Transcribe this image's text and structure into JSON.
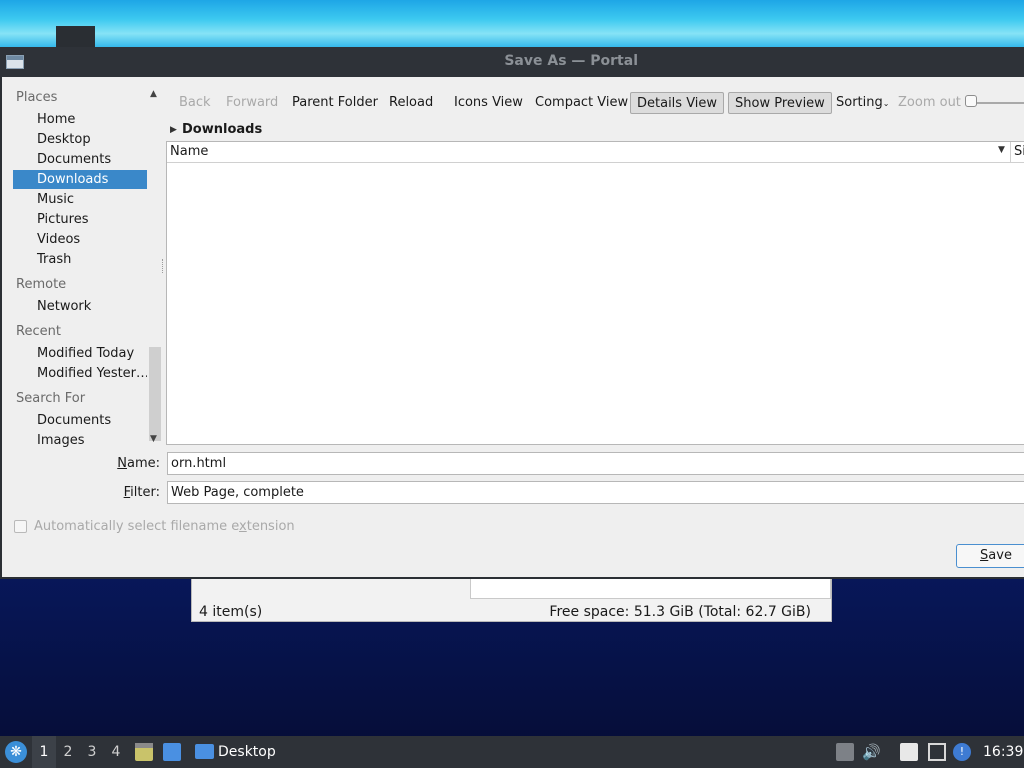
{
  "dialog": {
    "title": "Save As — Portal"
  },
  "places": {
    "sections": [
      {
        "title": "Places",
        "items": [
          "Home",
          "Desktop",
          "Documents",
          "Downloads",
          "Music",
          "Pictures",
          "Videos",
          "Trash"
        ]
      },
      {
        "title": "Remote",
        "items": [
          "Network"
        ]
      },
      {
        "title": "Recent",
        "items": [
          "Modified Today",
          "Modified Yester…"
        ]
      },
      {
        "title": "Search For",
        "items": [
          "Documents",
          "Images"
        ]
      }
    ],
    "selected": "Downloads"
  },
  "toolbar": {
    "back": "Back",
    "forward": "Forward",
    "parent_folder": "Parent Folder",
    "reload": "Reload",
    "icons_view": "Icons View",
    "compact_view": "Compact View",
    "details_view": "Details View",
    "show_preview": "Show Preview",
    "sorting": "Sorting",
    "zoom_out": "Zoom out"
  },
  "location": {
    "current": "Downloads"
  },
  "filelist": {
    "columns": [
      "Name",
      "Siz"
    ]
  },
  "form": {
    "name_label_pre": "",
    "name_label_accel": "N",
    "name_label_post": "ame:",
    "name_value": "orn.html",
    "filter_label_accel": "F",
    "filter_label_post": "ilter:",
    "filter_value": "Web Page, complete",
    "auto_ext_pre": "Automatically select filename e",
    "auto_ext_accel": "x",
    "auto_ext_post": "tension",
    "save_accel": "S",
    "save_post": "ave"
  },
  "background_window": {
    "items": "4 item(s)",
    "free_space": "Free space: 51.3 GiB (Total: 62.7 GiB)"
  },
  "taskbar": {
    "workspaces": [
      "1",
      "2",
      "3",
      "4"
    ],
    "active_workspace": "1",
    "task_label": "Desktop",
    "clock": "16:39",
    "icons": [
      "start-menu-icon",
      "file-manager-icon",
      "show-desktop-icon",
      "folder-icon",
      "tray-up-icon",
      "volume-icon",
      "clipboard-icon",
      "network-icon",
      "notification-icon"
    ]
  }
}
